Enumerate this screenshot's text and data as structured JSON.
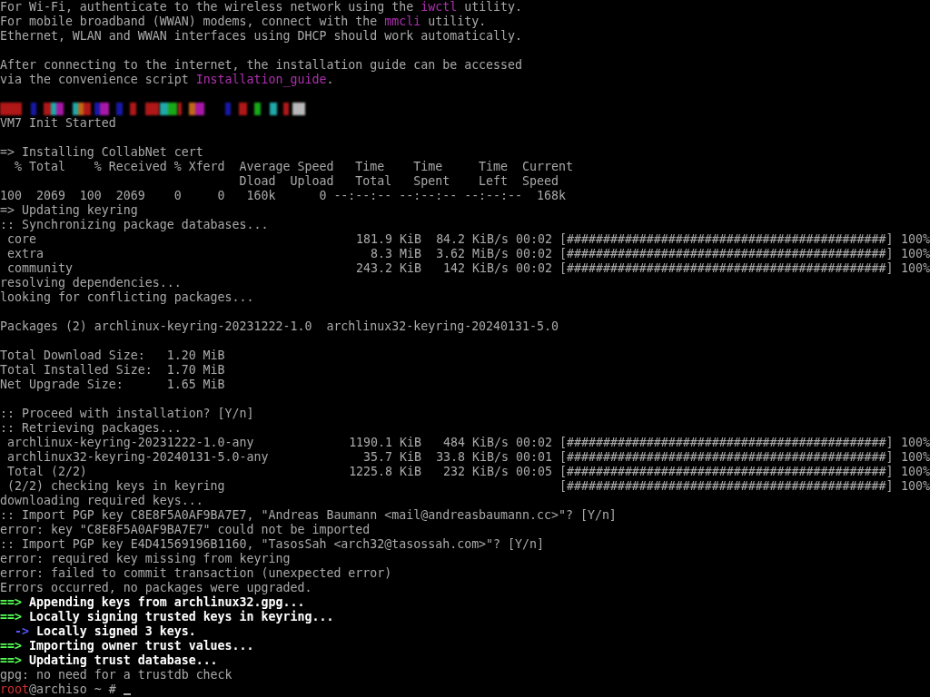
{
  "terminal": {
    "lines": [
      {
        "kind": "text",
        "segments": [
          {
            "text": "For Wi-Fi, authenticate to the wireless network using the ",
            "kind": "normal"
          },
          {
            "text": "iwctl",
            "kind": "magenta"
          },
          {
            "text": " utility.",
            "kind": "normal"
          }
        ]
      },
      {
        "kind": "text",
        "segments": [
          {
            "text": "For mobile broadband (WWAN) modems, connect with the ",
            "kind": "normal"
          },
          {
            "text": "mmcli",
            "kind": "magenta"
          },
          {
            "text": " utility.",
            "kind": "normal"
          }
        ]
      },
      {
        "kind": "text",
        "segments": [
          {
            "text": "Ethernet, WLAN and WWAN interfaces using DHCP should work automatically.",
            "kind": "normal"
          }
        ]
      },
      {
        "kind": "blank"
      },
      {
        "kind": "text",
        "segments": [
          {
            "text": "After connecting to the internet, the installation guide can be accessed",
            "kind": "normal"
          }
        ]
      },
      {
        "kind": "text",
        "segments": [
          {
            "text": "via the convenience script ",
            "kind": "normal"
          },
          {
            "text": "Installation_guide",
            "kind": "magenta"
          },
          {
            "text": ".",
            "kind": "normal"
          }
        ]
      },
      {
        "kind": "blank"
      },
      {
        "kind": "redacted"
      },
      {
        "kind": "text",
        "segments": [
          {
            "text": "VM7 Init Started",
            "kind": "normal"
          }
        ]
      },
      {
        "kind": "blank"
      },
      {
        "kind": "text",
        "segments": [
          {
            "text": "=> Installing CollabNet cert",
            "kind": "normal"
          }
        ]
      },
      {
        "kind": "text",
        "segments": [
          {
            "text": "  % Total    % Received % Xferd  Average Speed   Time    Time     Time  Current",
            "kind": "normal"
          }
        ]
      },
      {
        "kind": "text",
        "segments": [
          {
            "text": "                                 Dload  Upload   Total   Spent    Left  Speed",
            "kind": "normal"
          }
        ]
      },
      {
        "kind": "text",
        "segments": [
          {
            "text": "100  2069  100  2069    0     0   160k      0 --:--:-- --:--:-- --:--:--  168k",
            "kind": "normal"
          }
        ]
      },
      {
        "kind": "text",
        "segments": [
          {
            "text": "=> Updating keyring",
            "kind": "normal"
          }
        ]
      },
      {
        "kind": "text",
        "segments": [
          {
            "text": ":: Synchronizing package databases...",
            "kind": "normal"
          }
        ]
      },
      {
        "kind": "transfer",
        "name": "core",
        "size": "181.9 KiB",
        "speed": "84.2 KiB/s",
        "time": "00:02",
        "bar": "[############################################]",
        "percent": "100%"
      },
      {
        "kind": "transfer",
        "name": "extra",
        "size": "8.3 MiB",
        "speed": "3.62 MiB/s",
        "time": "00:02",
        "bar": "[############################################]",
        "percent": "100%"
      },
      {
        "kind": "transfer",
        "name": "community",
        "size": "243.2 KiB",
        "speed": "142 KiB/s",
        "time": "00:02",
        "bar": "[############################################]",
        "percent": "100%"
      },
      {
        "kind": "text",
        "segments": [
          {
            "text": "resolving dependencies...",
            "kind": "normal"
          }
        ]
      },
      {
        "kind": "text",
        "segments": [
          {
            "text": "looking for conflicting packages...",
            "kind": "normal"
          }
        ]
      },
      {
        "kind": "blank"
      },
      {
        "kind": "text",
        "segments": [
          {
            "text": "Packages (2) archlinux-keyring-20231222-1.0  archlinux32-keyring-20240131-5.0",
            "kind": "normal"
          }
        ]
      },
      {
        "kind": "blank"
      },
      {
        "kind": "text",
        "segments": [
          {
            "text": "Total Download Size:   1.20 MiB",
            "kind": "normal"
          }
        ]
      },
      {
        "kind": "text",
        "segments": [
          {
            "text": "Total Installed Size:  1.70 MiB",
            "kind": "normal"
          }
        ]
      },
      {
        "kind": "text",
        "segments": [
          {
            "text": "Net Upgrade Size:      1.65 MiB",
            "kind": "normal"
          }
        ]
      },
      {
        "kind": "blank"
      },
      {
        "kind": "text",
        "segments": [
          {
            "text": ":: Proceed with installation? [Y/n]",
            "kind": "normal"
          }
        ]
      },
      {
        "kind": "text",
        "segments": [
          {
            "text": ":: Retrieving packages...",
            "kind": "normal"
          }
        ]
      },
      {
        "kind": "transfer",
        "name": "archlinux-keyring-20231222-1.0-any",
        "size": "1190.1 KiB",
        "speed": "484 KiB/s",
        "time": "00:02",
        "bar": "[############################################]",
        "percent": "100%"
      },
      {
        "kind": "transfer",
        "name": "archlinux32-keyring-20240131-5.0-any",
        "size": "35.7 KiB",
        "speed": "33.8 KiB/s",
        "time": "00:01",
        "bar": "[############################################]",
        "percent": "100%"
      },
      {
        "kind": "transfer",
        "name": "Total (2/2)",
        "size": "1225.8 KiB",
        "speed": "232 KiB/s",
        "time": "00:05",
        "bar": "[############################################]",
        "percent": "100%"
      },
      {
        "kind": "step",
        "name": "(2/2) checking keys in keyring",
        "bar": "[############################################]",
        "percent": "100%"
      },
      {
        "kind": "text",
        "segments": [
          {
            "text": "downloading required keys...",
            "kind": "normal"
          }
        ]
      },
      {
        "kind": "text",
        "segments": [
          {
            "text": ":: Import PGP key C8E8F5A0AF9BA7E7, \"Andreas Baumann <mail@andreasbaumann.cc>\"? [Y/n]",
            "kind": "normal"
          }
        ]
      },
      {
        "kind": "text",
        "segments": [
          {
            "text": "error: key \"C8E8F5A0AF9BA7E7\" could not be imported",
            "kind": "normal"
          }
        ]
      },
      {
        "kind": "text",
        "segments": [
          {
            "text": ":: Import PGP key E4D41569196B1160, \"TasosSah <arch32@tasossah.com>\"? [Y/n]",
            "kind": "normal"
          }
        ]
      },
      {
        "kind": "text",
        "segments": [
          {
            "text": "error: required key missing from keyring",
            "kind": "normal"
          }
        ]
      },
      {
        "kind": "text",
        "segments": [
          {
            "text": "error: failed to commit transaction (unexpected error)",
            "kind": "normal"
          }
        ]
      },
      {
        "kind": "text",
        "segments": [
          {
            "text": "Errors occurred, no packages were upgraded.",
            "kind": "normal"
          }
        ]
      },
      {
        "kind": "text",
        "segments": [
          {
            "text": "==>",
            "kind": "green"
          },
          {
            "text": " Appending keys from archlinux32.gpg...",
            "kind": "bright"
          }
        ]
      },
      {
        "kind": "text",
        "segments": [
          {
            "text": "==>",
            "kind": "green"
          },
          {
            "text": " Locally signing trusted keys in keyring...",
            "kind": "bright"
          }
        ]
      },
      {
        "kind": "text",
        "segments": [
          {
            "text": "  ->",
            "kind": "blue"
          },
          {
            "text": " Locally signed 3 keys.",
            "kind": "bright"
          }
        ]
      },
      {
        "kind": "text",
        "segments": [
          {
            "text": "==>",
            "kind": "green"
          },
          {
            "text": " Importing owner trust values...",
            "kind": "bright"
          }
        ]
      },
      {
        "kind": "text",
        "segments": [
          {
            "text": "==>",
            "kind": "green"
          },
          {
            "text": " Updating trust database...",
            "kind": "bright"
          }
        ]
      },
      {
        "kind": "text",
        "segments": [
          {
            "text": "gpg: no need for a trustdb check",
            "kind": "normal"
          }
        ]
      },
      {
        "kind": "prompt",
        "cursor": true,
        "segments": [
          {
            "text": "root",
            "kind": "red"
          },
          {
            "text": "@archiso ~ #",
            "kind": "normal"
          }
        ]
      }
    ]
  }
}
